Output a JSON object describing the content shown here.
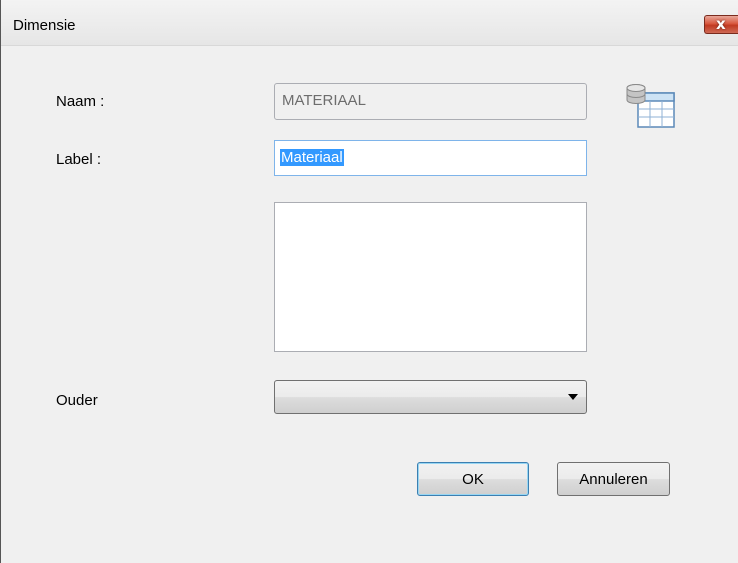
{
  "window": {
    "title": "Dimensie",
    "close_glyph": "x"
  },
  "form": {
    "naam_label": "Naam :",
    "naam_value": "MATERIAAL",
    "label_label": "Label :",
    "label_value": "Materiaal",
    "description_value": "",
    "ouder_label": "Ouder",
    "ouder_value": ""
  },
  "buttons": {
    "ok": "OK",
    "cancel": "Annuleren"
  },
  "icons": {
    "table_picker": "database-table-icon",
    "close": "close-icon",
    "dropdown": "chevron-down-icon"
  },
  "colors": {
    "close_button": "#c13a22",
    "selection": "#3399ff",
    "focus_border": "#7eb4ea"
  }
}
